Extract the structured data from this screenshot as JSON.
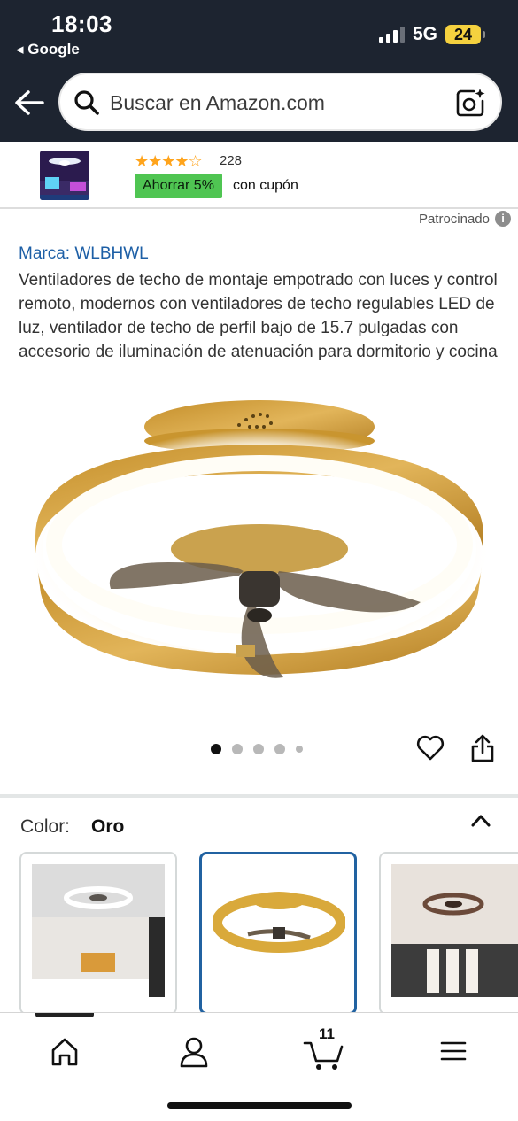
{
  "status_bar": {
    "time": "18:03",
    "back_app": "◂ Google",
    "network": "5G",
    "battery": "24"
  },
  "search": {
    "placeholder": "Buscar en Amazon.com"
  },
  "sponsored_ad": {
    "stars": "★★★★☆",
    "rating": 4,
    "review_count": "228",
    "coupon": "Ahorrar 5%",
    "coupon_text": "con cupón"
  },
  "sponsored_label": "Patrocinado",
  "product": {
    "brand": "Marca: WLBHWL",
    "title": "Ventiladores de techo de montaje empotrado con luces y control remoto, modernos con ventiladores de techo regulables LED de luz, ventilador de techo de perfil bajo de 15.7 pulgadas con accesorio de iluminación de atenuación para dormitorio y cocina"
  },
  "carousel": {
    "total": 5,
    "active": 0
  },
  "variant": {
    "label": "Color:",
    "value": "Oro"
  },
  "bottom_nav": {
    "cart_count": "11"
  },
  "colors": {
    "header_bg": "#1d2430",
    "link": "#1d5fa6",
    "coupon_bg": "#4fc552",
    "star": "#ffa41c",
    "selected_border": "#2162a1",
    "gold": "#d9a93b"
  },
  "icons": [
    "back-arrow-icon",
    "search-icon",
    "camera-icon",
    "info-icon",
    "heart-icon",
    "share-icon",
    "chevron-up-icon",
    "home-icon",
    "account-icon",
    "cart-icon",
    "menu-icon"
  ]
}
